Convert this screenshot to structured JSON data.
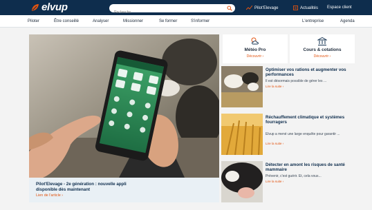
{
  "header": {
    "logo_text": "elvup",
    "search_placeholder": "Recherche",
    "links": [
      "Pilot'Elevage",
      "Actualités",
      "Espace client"
    ]
  },
  "nav": {
    "left": [
      "Piloter",
      "Être conseillé",
      "Analyser",
      "Missionner",
      "Se former",
      "S'informer"
    ],
    "right": [
      "L'entreprise",
      "Agenda"
    ]
  },
  "hero": {
    "title": "Pilot'Elevage - 2e génération : nouvelle appli disponible dès maintenant",
    "link": "Lien de l'article  ›"
  },
  "tiles": [
    {
      "title": "Météo Pro",
      "link": "Découvrir  ›",
      "icon": "weather-icon"
    },
    {
      "title": "Cours & cotations",
      "link": "Découvrir  ›",
      "icon": "bank-icon"
    }
  ],
  "news": [
    {
      "title": "Optimiser vos rations et augmenter vos performances",
      "text": "Il est désormais possible de gérer les ...",
      "link": "Lire la suite  ›"
    },
    {
      "title": "Réchauffement climatique et systèmes fourragers",
      "text": "Elvup a mené une large enquête pour garantir ...",
      "link": "Lire la suite  ›"
    },
    {
      "title": "Détecter en amont les risques de santé mammaire",
      "text": "Prévenir, c'est guérir. Et, cela vous...",
      "link": "Lire la suite  ›"
    }
  ],
  "colors": {
    "navy": "#0e2d4d",
    "accent": "#e2530f",
    "green": "#2f8f56"
  }
}
